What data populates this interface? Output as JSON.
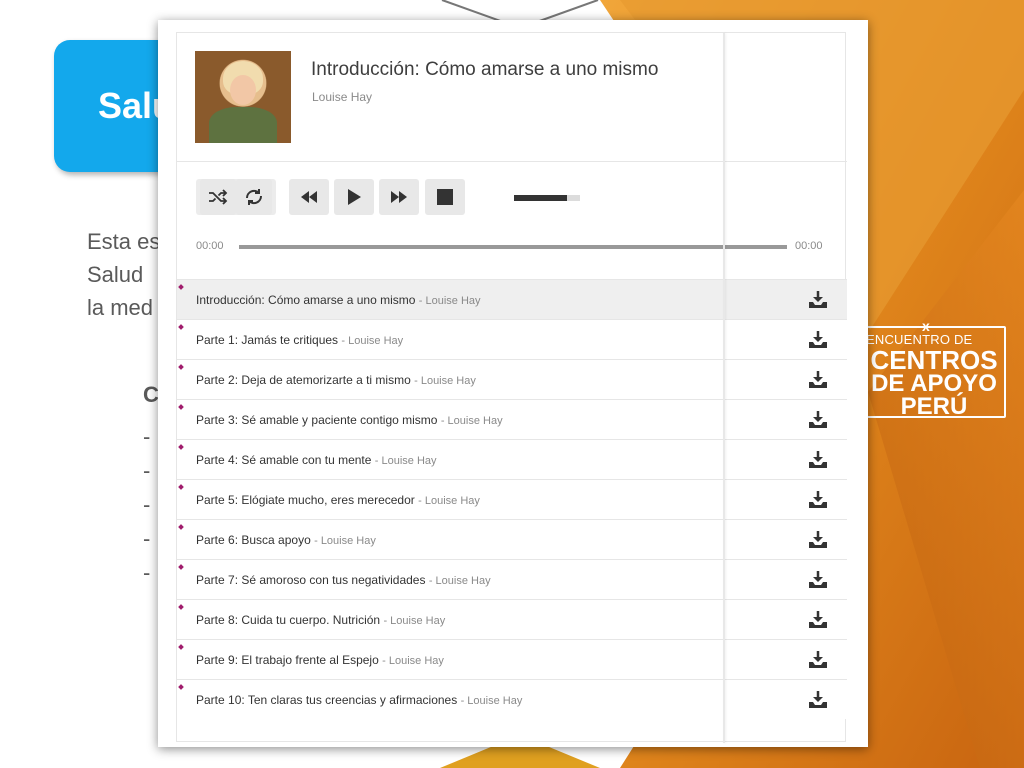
{
  "slide": {
    "title": "Salu",
    "body_lines": [
      "Esta es",
      "Salud",
      "la med"
    ],
    "subheading": "C",
    "bullets": [
      "-",
      "-",
      "-",
      "-",
      "-"
    ],
    "logo": {
      "line1": "ENCUENTRO DE",
      "line2": "CENTROS",
      "line3": "DE APOYO",
      "line4": "PERÚ",
      "mark": "x"
    },
    "colors": {
      "title_box": "#13a8ec",
      "background_orange": "#e0861c"
    }
  },
  "player": {
    "now_playing": {
      "title": "Introducción: Cómo amarse a uno mismo",
      "artist": "Louise Hay"
    },
    "controls": {
      "shuffle_icon": "shuffle-icon",
      "repeat_icon": "repeat-icon",
      "prev_icon": "previous-icon",
      "play_icon": "play-icon",
      "next_icon": "next-icon",
      "stop_icon": "stop-icon"
    },
    "volume_level": 0.8,
    "progress": 0,
    "time_elapsed": "00:00",
    "time_total": "00:00",
    "playlist": [
      {
        "title": "Introducción: Cómo amarse a uno mismo",
        "artist": "- Louise Hay",
        "active": true
      },
      {
        "title": "Parte 1: Jamás te critiques",
        "artist": "- Louise Hay",
        "active": false
      },
      {
        "title": "Parte 2: Deja de atemorizarte a ti mismo",
        "artist": "- Louise Hay",
        "active": false
      },
      {
        "title": "Parte 3: Sé amable y paciente contigo mismo",
        "artist": "- Louise Hay",
        "active": false
      },
      {
        "title": "Parte 4: Sé amable con tu mente",
        "artist": "- Louise Hay",
        "active": false
      },
      {
        "title": "Parte 5: Elógiate mucho, eres merecedor",
        "artist": "- Louise Hay",
        "active": false
      },
      {
        "title": "Parte 6: Busca apoyo",
        "artist": "- Louise Hay",
        "active": false
      },
      {
        "title": "Parte 7: Sé amoroso con tus negatividades",
        "artist": "- Louise Hay",
        "active": false
      },
      {
        "title": "Parte 8: Cuida tu cuerpo. Nutrición",
        "artist": "- Louise Hay",
        "active": false
      },
      {
        "title": "Parte 9: El trabajo frente al Espejo",
        "artist": "- Louise Hay",
        "active": false
      },
      {
        "title": "Parte 10: Ten claras tus creencias y afirmaciones",
        "artist": "- Louise Hay",
        "active": false
      }
    ],
    "download_icon": "download-icon",
    "accent_color": "#a01c6c"
  }
}
